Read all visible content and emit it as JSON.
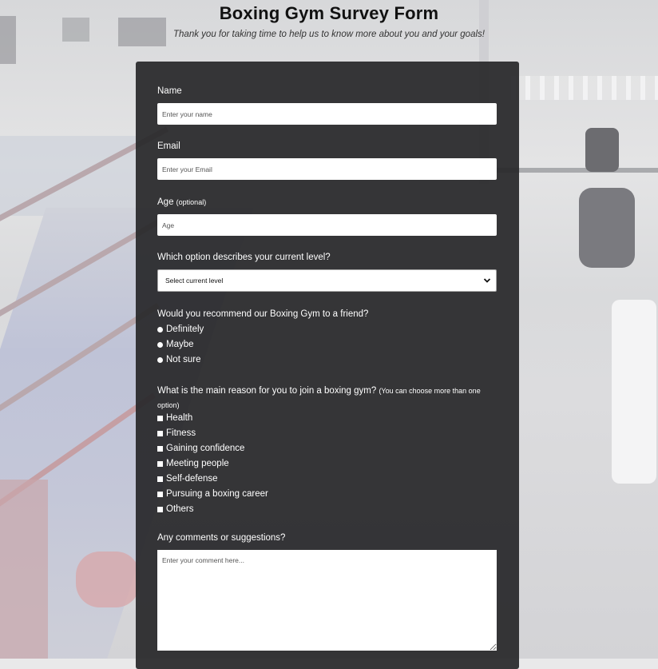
{
  "header": {
    "title": "Boxing Gym Survey Form",
    "subtitle": "Thank you for taking time to help us to know more about you and your goals!"
  },
  "form": {
    "name": {
      "label": "Name",
      "placeholder": "Enter your name",
      "value": ""
    },
    "email": {
      "label": "Email",
      "placeholder": "Enter your Email",
      "value": ""
    },
    "age": {
      "label": "Age",
      "label_note": "(optional)",
      "placeholder": "Age",
      "value": ""
    },
    "level": {
      "label": "Which option describes your current level?",
      "selected": "Select current level"
    },
    "recommend": {
      "label": "Would you recommend our Boxing Gym to a friend?",
      "options": [
        "Definitely",
        "Maybe",
        "Not sure"
      ]
    },
    "reasons": {
      "label": "What is the main reason for you to join a boxing gym?",
      "label_note": "(You can choose more than one option)",
      "options": [
        "Health",
        "Fitness",
        "Gaining confidence",
        "Meeting people",
        "Self-defense",
        "Pursuing a boxing career",
        "Others"
      ]
    },
    "comments": {
      "label": "Any comments or suggestions?",
      "placeholder": "Enter your comment here..."
    }
  }
}
